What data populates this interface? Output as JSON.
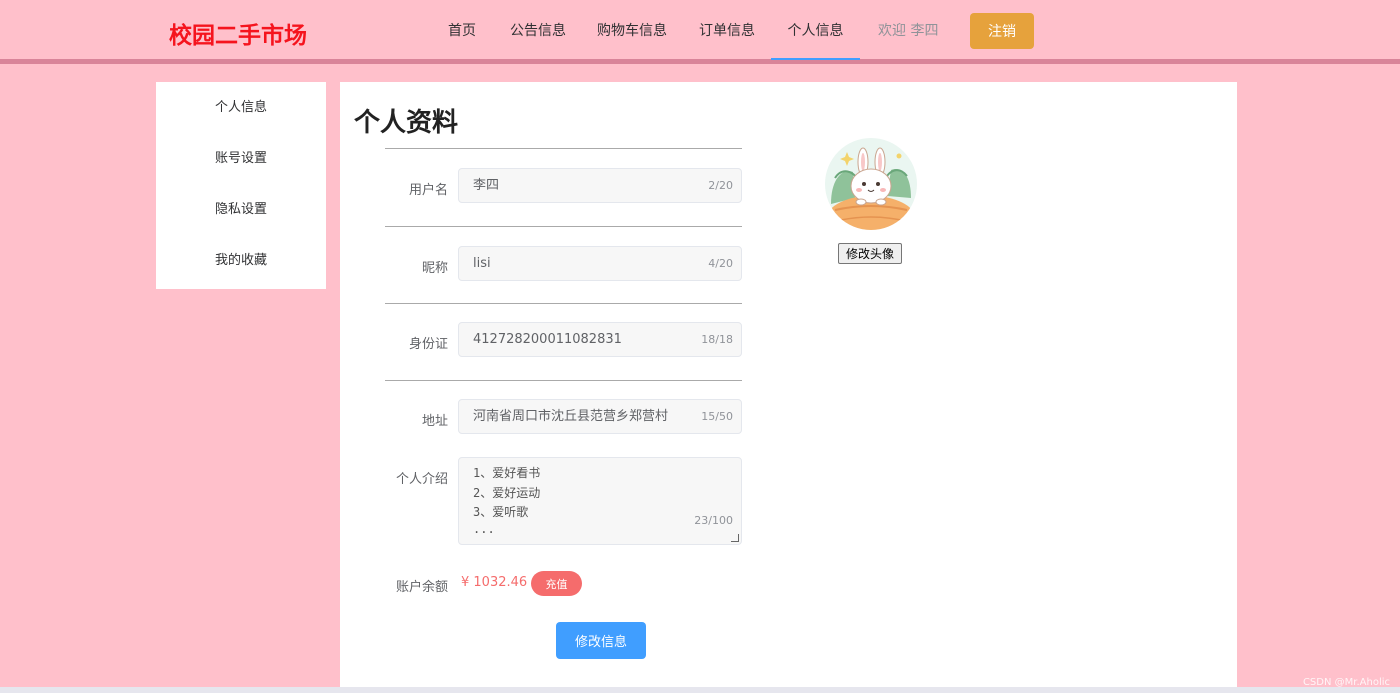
{
  "header": {
    "brand": "校园二手市场",
    "nav": [
      "首页",
      "公告信息",
      "购物车信息",
      "订单信息",
      "个人信息"
    ],
    "active_nav": "个人信息",
    "welcome": "欢迎 李四",
    "logout_label": "注销"
  },
  "sidebar": {
    "items": [
      "个人信息",
      "账号设置",
      "隐私设置",
      "我的收藏"
    ]
  },
  "profile": {
    "title": "个人资料",
    "fields": {
      "username": {
        "label": "用户名",
        "value": "李四",
        "count": "2/20"
      },
      "nickname": {
        "label": "昵称",
        "value": "lisi",
        "count": "4/20"
      },
      "idcard": {
        "label": "身份证",
        "value": "412728200011082831",
        "count": "18/18"
      },
      "address": {
        "label": "地址",
        "value": "河南省周口市沈丘县范营乡郑营村",
        "count": "15/50"
      }
    },
    "intro": {
      "label": "个人介绍",
      "lines": [
        "1、爱好看书",
        "2、爱好运动",
        "3、爱听歌",
        "..."
      ],
      "count": "23/100"
    },
    "balance": {
      "label": "账户余额",
      "value": "¥ 1032.46",
      "recharge_label": "充值"
    },
    "submit_label": "修改信息",
    "avatar_button_label": "修改头像"
  },
  "watermark": "CSDN @Mr.Aholic",
  "colors": {
    "background": "#ffc0cb",
    "brand": "#f5141e",
    "warning": "#e6a23c",
    "danger": "#f56c6c",
    "primary": "#409eff"
  }
}
